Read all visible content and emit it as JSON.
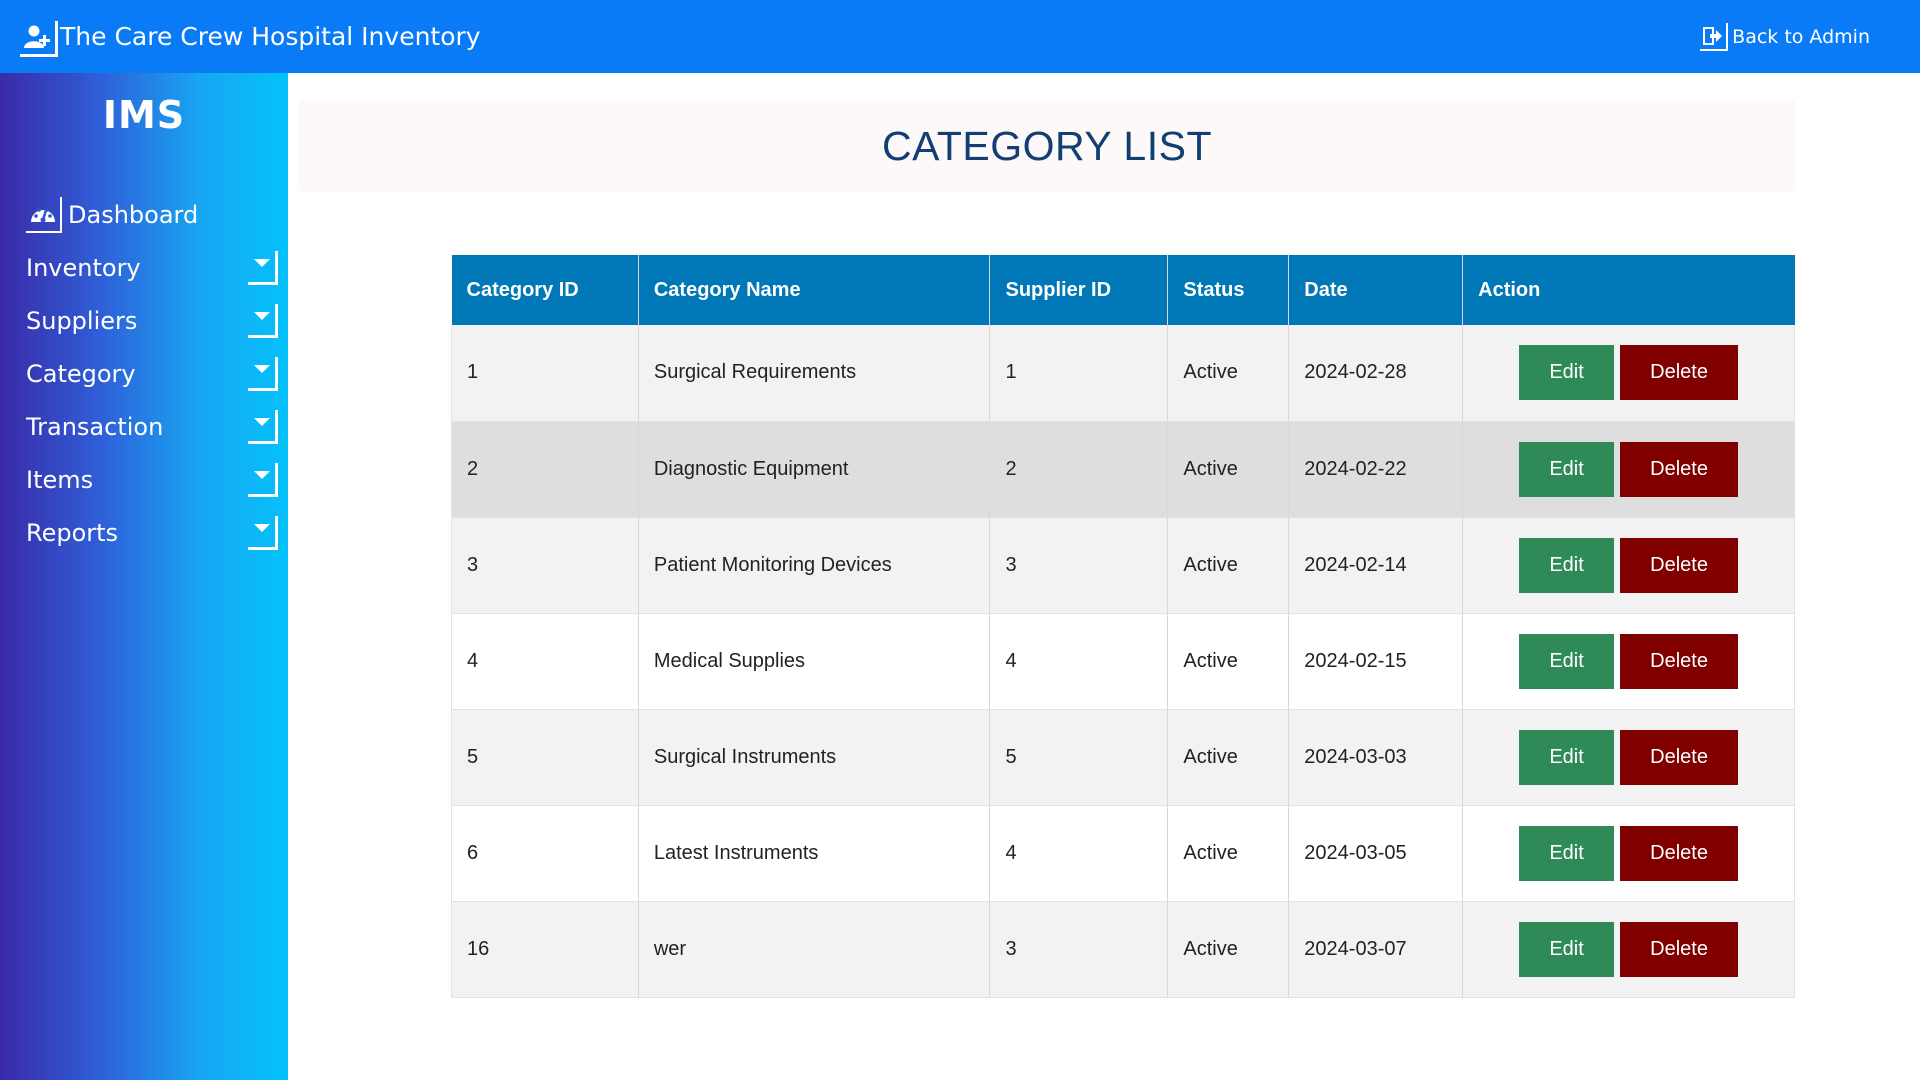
{
  "app": {
    "title": "The Care Crew Hospital Inventory",
    "back_label": "Back to Admin",
    "brand_color": "#0a7bf7"
  },
  "sidebar": {
    "logo": "IMS",
    "items": [
      {
        "label": "Dashboard",
        "icon": "dashboard-gauge-icon"
      },
      {
        "label": "Inventory",
        "icon": "caret-down-icon"
      },
      {
        "label": "Suppliers",
        "icon": "caret-down-icon"
      },
      {
        "label": "Category",
        "icon": "caret-down-icon"
      },
      {
        "label": "Transaction",
        "icon": "caret-down-icon"
      },
      {
        "label": "Items",
        "icon": "caret-down-icon"
      },
      {
        "label": "Reports",
        "icon": "caret-down-icon"
      }
    ]
  },
  "main": {
    "title": "CATEGORY LIST",
    "table": {
      "headers": [
        "Category ID",
        "Category Name",
        "Supplier ID",
        "Status",
        "Date",
        "Action"
      ],
      "edit_label": "Edit",
      "delete_label": "Delete",
      "rows": [
        {
          "id": "1",
          "name": "Surgical Requirements",
          "supplier_id": "1",
          "status": "Active",
          "date": "2024-02-28"
        },
        {
          "id": "2",
          "name": "Diagnostic Equipment",
          "supplier_id": "2",
          "status": "Active",
          "date": "2024-02-22"
        },
        {
          "id": "3",
          "name": "Patient Monitoring Devices",
          "supplier_id": "3",
          "status": "Active",
          "date": "2024-02-14"
        },
        {
          "id": "4",
          "name": "Medical Supplies",
          "supplier_id": "4",
          "status": "Active",
          "date": "2024-02-15"
        },
        {
          "id": "5",
          "name": "Surgical Instruments",
          "supplier_id": "5",
          "status": "Active",
          "date": "2024-03-03"
        },
        {
          "id": "6",
          "name": "Latest Instruments",
          "supplier_id": "4",
          "status": "Active",
          "date": "2024-03-05"
        },
        {
          "id": "16",
          "name": "wer",
          "supplier_id": "3",
          "status": "Active",
          "date": "2024-03-07"
        }
      ]
    }
  }
}
